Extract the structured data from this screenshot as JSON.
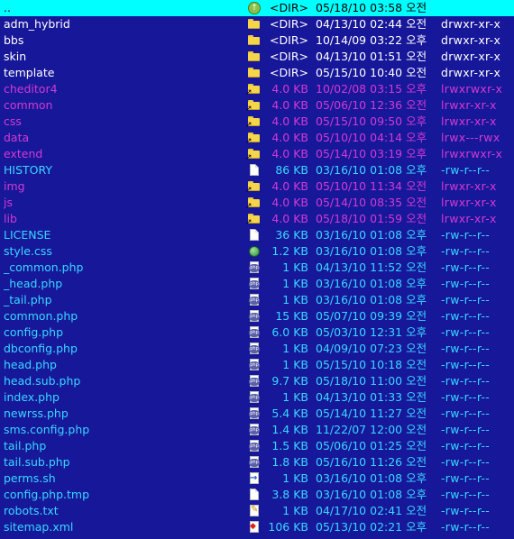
{
  "files": [
    {
      "name": "..",
      "icon": "up-arrow-icon",
      "size": "<DIR>",
      "date": "05/18/10 03:58 오전",
      "perm": "",
      "kind": "selected"
    },
    {
      "name": "adm_hybrid",
      "icon": "folder-icon",
      "size": "<DIR>",
      "date": "04/13/10 02:44 오전",
      "perm": "drwxr-xr-x",
      "kind": "dir"
    },
    {
      "name": "bbs",
      "icon": "folder-icon",
      "size": "<DIR>",
      "date": "10/14/09 03:22 오후",
      "perm": "drwxr-xr-x",
      "kind": "dir"
    },
    {
      "name": "skin",
      "icon": "folder-icon",
      "size": "<DIR>",
      "date": "04/13/10 01:51 오전",
      "perm": "drwxr-xr-x",
      "kind": "dir"
    },
    {
      "name": "template",
      "icon": "folder-icon",
      "size": "<DIR>",
      "date": "05/15/10 10:40 오전",
      "perm": "drwxr-xr-x",
      "kind": "dir"
    },
    {
      "name": "cheditor4",
      "icon": "folder-link-icon",
      "size": "4.0 KB",
      "date": "10/02/08 03:15 오후",
      "perm": "lrwxrwxr-x",
      "kind": "link"
    },
    {
      "name": "common",
      "icon": "folder-link-icon",
      "size": "4.0 KB",
      "date": "05/06/10 12:36 오전",
      "perm": "lrwxr-xr-x",
      "kind": "link"
    },
    {
      "name": "css",
      "icon": "folder-link-icon",
      "size": "4.0 KB",
      "date": "05/15/10 09:50 오후",
      "perm": "lrwxr-xr-x",
      "kind": "link"
    },
    {
      "name": "data",
      "icon": "folder-link-icon",
      "size": "4.0 KB",
      "date": "05/10/10 04:14 오후",
      "perm": "lrwx---rwx",
      "kind": "link"
    },
    {
      "name": "extend",
      "icon": "folder-link-icon",
      "size": "4.0 KB",
      "date": "05/14/10 03:19 오후",
      "perm": "lrwxrwxr-x",
      "kind": "link"
    },
    {
      "name": "HISTORY",
      "icon": "document-icon",
      "size": "86 KB",
      "date": "03/16/10 01:08 오후",
      "perm": "-rw-r--r--",
      "kind": "file"
    },
    {
      "name": "img",
      "icon": "folder-link-icon",
      "size": "4.0 KB",
      "date": "05/10/10 11:34 오전",
      "perm": "lrwxr-xr-x",
      "kind": "link"
    },
    {
      "name": "js",
      "icon": "folder-link-icon",
      "size": "4.0 KB",
      "date": "05/14/10 08:35 오전",
      "perm": "lrwxr-xr-x",
      "kind": "link"
    },
    {
      "name": "lib",
      "icon": "folder-link-icon",
      "size": "4.0 KB",
      "date": "05/18/10 01:59 오전",
      "perm": "lrwxr-xr-x",
      "kind": "link"
    },
    {
      "name": "LICENSE",
      "icon": "document-icon",
      "size": "36 KB",
      "date": "03/16/10 01:08 오후",
      "perm": "-rw-r--r--",
      "kind": "file"
    },
    {
      "name": "style.css",
      "icon": "css-icon",
      "size": "1.2 KB",
      "date": "03/16/10 01:08 오후",
      "perm": "-rw-r--r--",
      "kind": "file"
    },
    {
      "name": "_common.php",
      "icon": "php-icon",
      "size": "1 KB",
      "date": "04/13/10 11:52 오전",
      "perm": "-rw-r--r--",
      "kind": "file"
    },
    {
      "name": "_head.php",
      "icon": "php-icon",
      "size": "1 KB",
      "date": "03/16/10 01:08 오후",
      "perm": "-rw-r--r--",
      "kind": "file"
    },
    {
      "name": "_tail.php",
      "icon": "php-icon",
      "size": "1 KB",
      "date": "03/16/10 01:08 오후",
      "perm": "-rw-r--r--",
      "kind": "file"
    },
    {
      "name": "common.php",
      "icon": "php-icon",
      "size": "15 KB",
      "date": "05/07/10 09:39 오전",
      "perm": "-rw-r--r--",
      "kind": "file"
    },
    {
      "name": "config.php",
      "icon": "php-icon",
      "size": "6.0 KB",
      "date": "05/03/10 12:31 오후",
      "perm": "-rw-r--r--",
      "kind": "file"
    },
    {
      "name": "dbconfig.php",
      "icon": "php-icon",
      "size": "1 KB",
      "date": "04/09/10 07:23 오전",
      "perm": "-rw-r--r--",
      "kind": "file"
    },
    {
      "name": "head.php",
      "icon": "php-icon",
      "size": "1 KB",
      "date": "05/15/10 10:18 오전",
      "perm": "-rw-r--r--",
      "kind": "file"
    },
    {
      "name": "head.sub.php",
      "icon": "php-icon",
      "size": "9.7 KB",
      "date": "05/18/10 11:00 오전",
      "perm": "-rw-r--r--",
      "kind": "file"
    },
    {
      "name": "index.php",
      "icon": "php-icon",
      "size": "1 KB",
      "date": "04/13/10 01:33 오전",
      "perm": "-rw-r--r--",
      "kind": "file"
    },
    {
      "name": "newrss.php",
      "icon": "php-icon",
      "size": "5.4 KB",
      "date": "05/14/10 11:27 오전",
      "perm": "-rw-r--r--",
      "kind": "file"
    },
    {
      "name": "sms.config.php",
      "icon": "php-icon",
      "size": "1.4 KB",
      "date": "11/22/07 12:00 오전",
      "perm": "-rw-r--r--",
      "kind": "file"
    },
    {
      "name": "tail.php",
      "icon": "php-icon",
      "size": "1.5 KB",
      "date": "05/06/10 01:25 오전",
      "perm": "-rw-r--r--",
      "kind": "file"
    },
    {
      "name": "tail.sub.php",
      "icon": "php-icon",
      "size": "1.8 KB",
      "date": "05/16/10 11:26 오전",
      "perm": "-rw-r--r--",
      "kind": "file"
    },
    {
      "name": "perms.sh",
      "icon": "shell-script-icon",
      "size": "1 KB",
      "date": "03/16/10 01:08 오후",
      "perm": "-rw-r--r--",
      "kind": "file"
    },
    {
      "name": "config.php.tmp",
      "icon": "document-icon",
      "size": "3.8 KB",
      "date": "03/16/10 01:08 오후",
      "perm": "-rw-r--r--",
      "kind": "file"
    },
    {
      "name": "robots.txt",
      "icon": "text-file-icon",
      "size": "1 KB",
      "date": "04/17/10 02:41 오전",
      "perm": "-rw-r--r--",
      "kind": "file"
    },
    {
      "name": "sitemap.xml",
      "icon": "xml-file-icon",
      "size": "106 KB",
      "date": "05/13/10 02:21 오후",
      "perm": "-rw-r--r--",
      "kind": "file"
    }
  ]
}
